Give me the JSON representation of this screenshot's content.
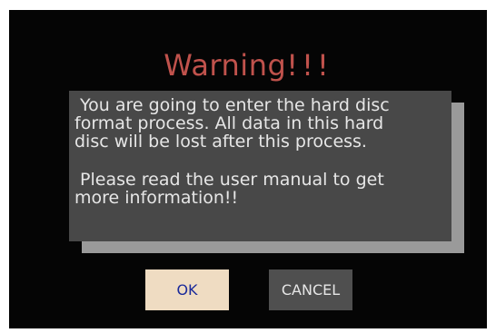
{
  "dialog": {
    "title": "Warning",
    "title_emphasis": "!!!",
    "message_1": " You are going to enter the hard disc\nformat process. All data in this hard\ndisc will be lost after this process.",
    "message_2": " Please read the user manual to get\nmore information!!",
    "ok_label": "OK",
    "cancel_label": "CANCEL"
  },
  "colors": {
    "title": "#c0524c",
    "panel": "#484848",
    "panel_shadow": "#9a9a9a",
    "ok_button": "#efdcc2",
    "ok_text": "#1a2a9a",
    "cancel_button": "#4f4f4f",
    "background": "#050505"
  }
}
